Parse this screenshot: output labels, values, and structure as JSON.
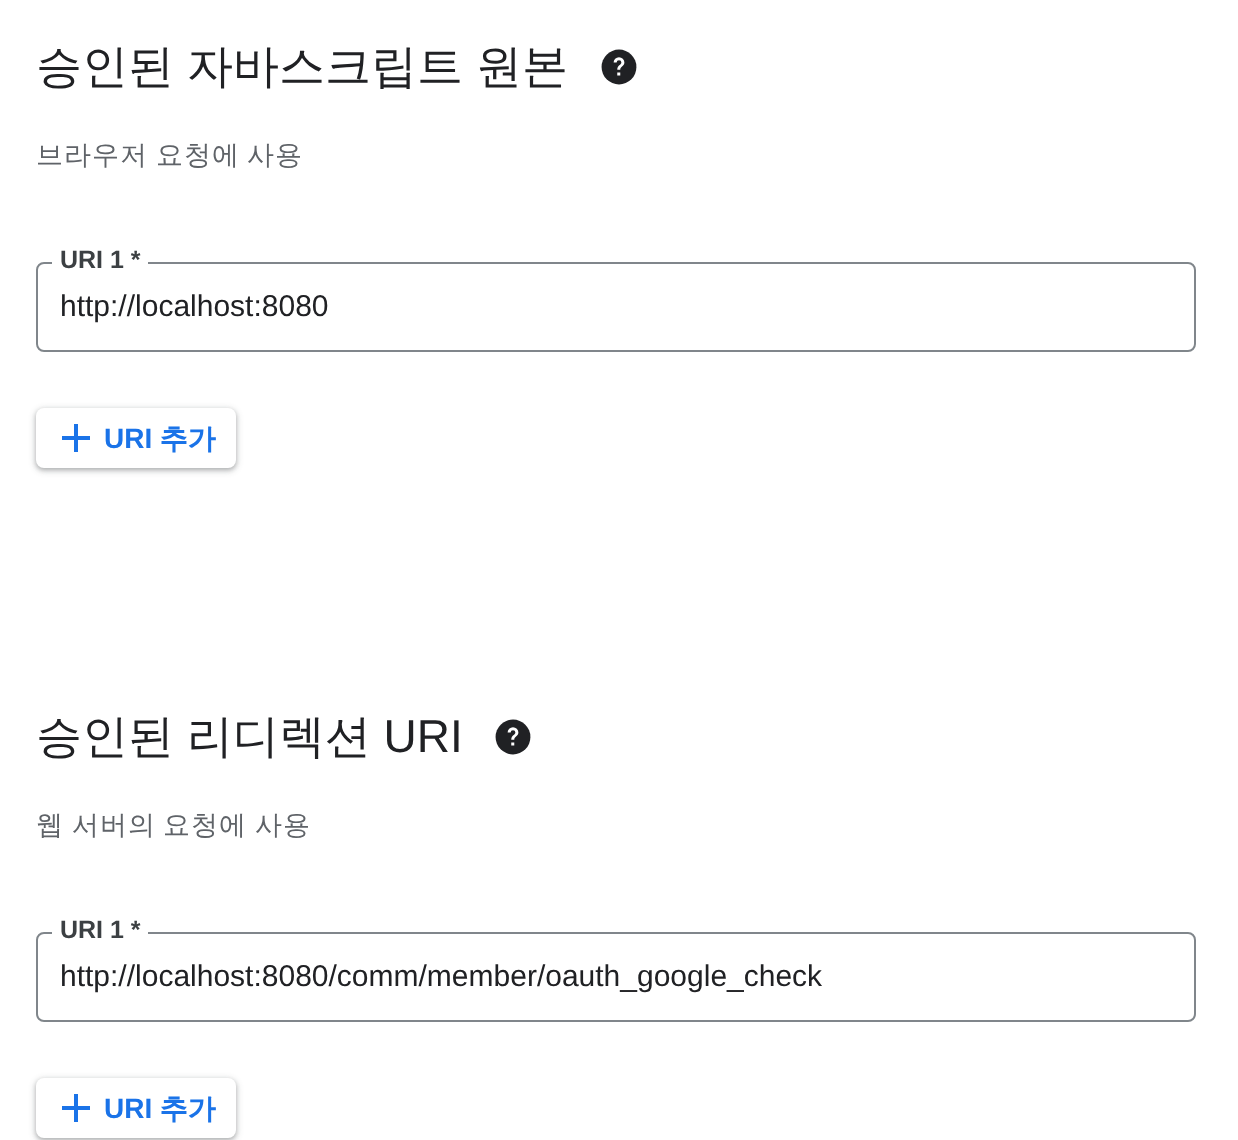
{
  "sections": [
    {
      "title": "승인된 자바스크립트 원본",
      "subtitle": "브라우저 요청에 사용",
      "fields": [
        {
          "label": "URI 1 *",
          "value": "http://localhost:8080"
        }
      ],
      "add_button": "URI 추가"
    },
    {
      "title": "승인된 리디렉션 URI",
      "subtitle": "웹 서버의 요청에 사용",
      "fields": [
        {
          "label": "URI 1 *",
          "value": "http://localhost:8080/comm/member/oauth_google_check"
        }
      ],
      "add_button": "URI 추가"
    }
  ]
}
